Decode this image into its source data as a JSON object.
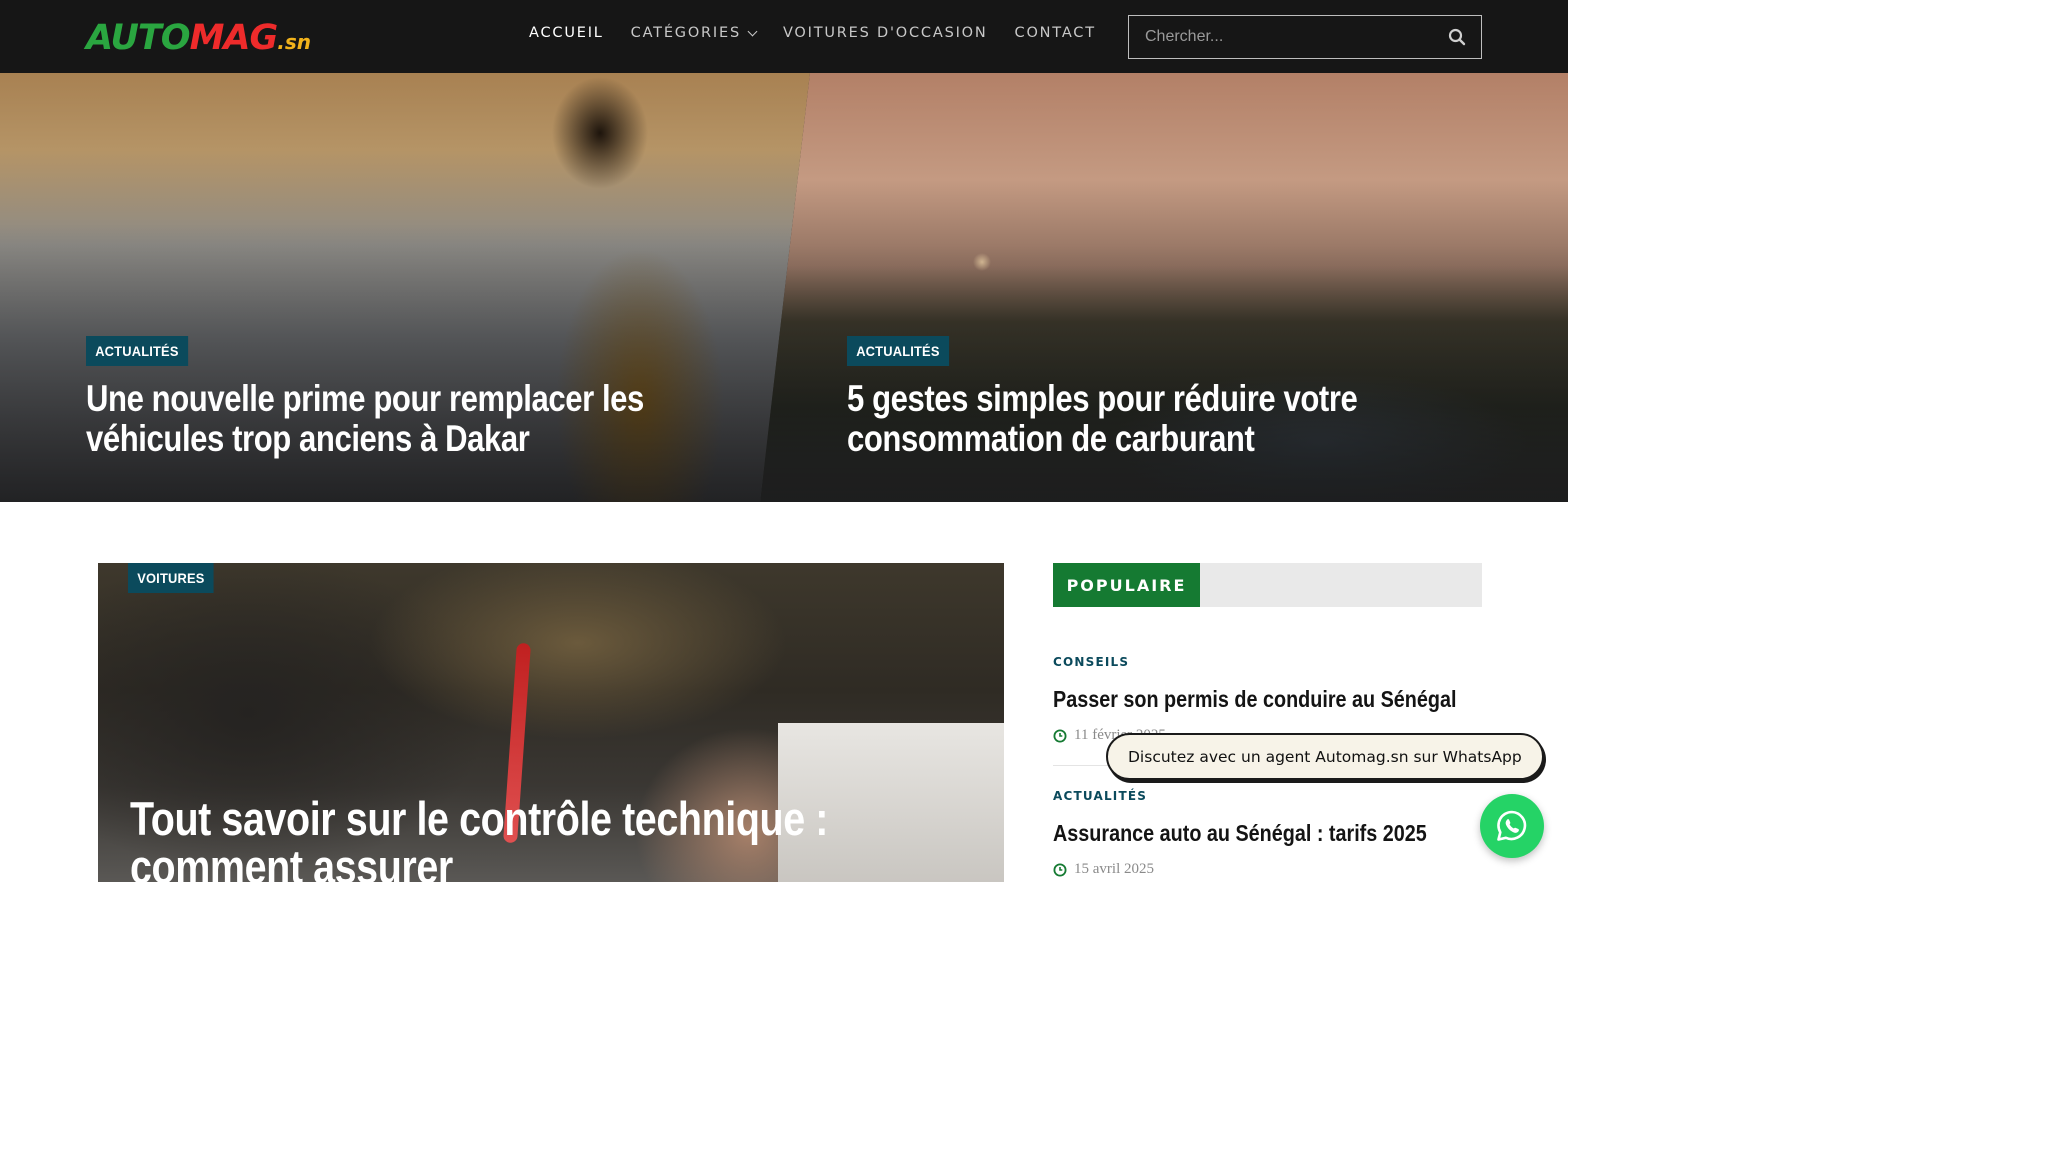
{
  "header": {
    "logo": {
      "part1": "AUTO",
      "part2": "MAG",
      "part3": ".sn"
    },
    "nav": [
      {
        "label": "ACCUEIL",
        "active": true
      },
      {
        "label": "CATÉGORIES",
        "dropdown": true
      },
      {
        "label": "VOITURES D'OCCASION"
      },
      {
        "label": "CONTACT"
      }
    ],
    "search": {
      "placeholder": "Chercher...",
      "icon": "search-icon"
    }
  },
  "hero": [
    {
      "category": "ACTUALITÉS",
      "title": "Une nouvelle prime pour remplacer les véhicules trop anciens à Dakar"
    },
    {
      "category": "ACTUALITÉS",
      "title": "5 gestes simples pour réduire votre consommation de carburant"
    }
  ],
  "feature": {
    "category": "VOITURES",
    "title": "Tout savoir sur le contrôle technique : comment assurer"
  },
  "sidebar": {
    "heading": "POPULAIRE",
    "items": [
      {
        "category": "CONSEILS",
        "title": "Passer son permis de conduire au Sénégal",
        "date": "11 février 2025"
      },
      {
        "category": "ACTUALITÉS",
        "title": "Assurance auto au Sénégal : tarifs 2025",
        "date": "15 avril 2025"
      }
    ]
  },
  "whatsapp": {
    "message": "Discutez avec un agent Automag.sn sur WhatsApp"
  },
  "colors": {
    "header_bg": "#161616",
    "brand_green": "#2aa640",
    "brand_red": "#ee2b2b",
    "brand_yellow": "#f2b31b",
    "badge_bg": "#0b4a5c",
    "popular_bg": "#157a32",
    "whatsapp_green": "#25d366"
  }
}
